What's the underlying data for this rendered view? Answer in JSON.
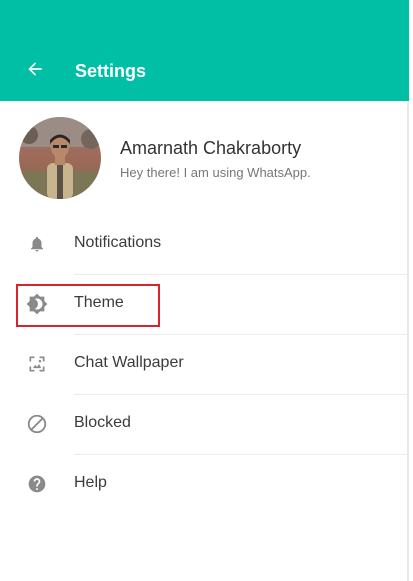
{
  "header": {
    "title": "Settings",
    "back_icon": "arrow-left-icon",
    "background_color": "#00bfa5"
  },
  "profile": {
    "name": "Amarnath Chakraborty",
    "status": "Hey there! I am using WhatsApp."
  },
  "menu": {
    "items": [
      {
        "label": "Notifications",
        "icon": "bell-icon"
      },
      {
        "label": "Theme",
        "icon": "brightness-icon",
        "highlighted": true
      },
      {
        "label": "Chat Wallpaper",
        "icon": "wallpaper-icon"
      },
      {
        "label": "Blocked",
        "icon": "blocked-icon"
      },
      {
        "label": "Help",
        "icon": "help-icon"
      }
    ]
  },
  "colors": {
    "accent": "#00bfa5",
    "highlight_border": "#d9242c",
    "icon_gray": "#8a8a8a"
  }
}
